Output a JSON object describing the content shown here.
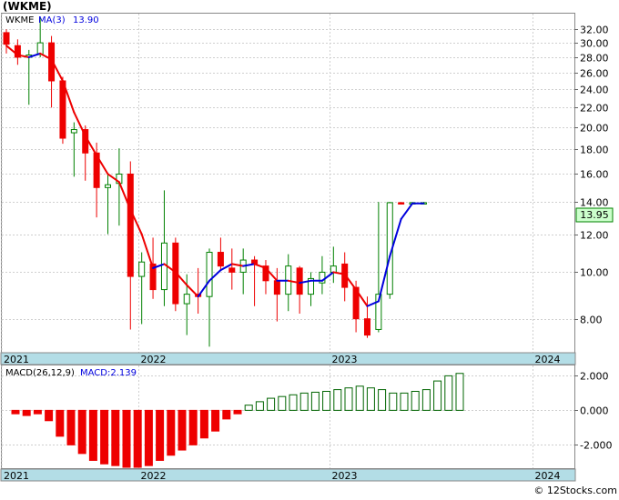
{
  "ticker_title": "(WKME)",
  "footer": "© 12Stocks.com",
  "colors": {
    "up": "#008000",
    "down": "#ee0000",
    "ma_up": "#0000dd",
    "ma_down": "#ee0000",
    "macd_hist": "#ee0000",
    "macd_hist_pos": "#006400",
    "axis_band": "#b3dde6",
    "price_tag_bg": "#ccffcc"
  },
  "chart_data": [
    {
      "type": "candlestick",
      "legend": {
        "symbol": "WKME",
        "ma_label": "MA(3)",
        "ma_value": "13.90"
      },
      "scale": "log",
      "ylim": [
        6.8,
        34.5
      ],
      "y_ticks": [
        {
          "v": 32,
          "label": "32.00"
        },
        {
          "v": 30,
          "label": "30.00"
        },
        {
          "v": 28,
          "label": "28.00"
        },
        {
          "v": 26,
          "label": "26.00"
        },
        {
          "v": 24,
          "label": "24.00"
        },
        {
          "v": 22,
          "label": "22.00"
        },
        {
          "v": 20,
          "label": "20.00"
        },
        {
          "v": 18,
          "label": "18.00"
        },
        {
          "v": 16,
          "label": "16.00"
        },
        {
          "v": 14,
          "label": "14.00"
        },
        {
          "v": 12,
          "label": "12.00"
        },
        {
          "v": 10,
          "label": "10.00"
        },
        {
          "v": 8,
          "label": "8.00"
        }
      ],
      "last_price_label": "13.95",
      "last_price": 13.95,
      "x_ticks": [
        {
          "i": 0,
          "label": "2021"
        },
        {
          "i": 12,
          "label": "2022"
        },
        {
          "i": 29,
          "label": "2023"
        },
        {
          "i": 47,
          "label": "2024"
        }
      ],
      "ohlc": [
        [
          31.5,
          32.0,
          28.5,
          29.8
        ],
        [
          29.6,
          30.5,
          27.0,
          28.0
        ],
        [
          28.0,
          29.0,
          22.3,
          28.3
        ],
        [
          28.4,
          33.8,
          28.0,
          30.0
        ],
        [
          30.0,
          31.0,
          22.0,
          25.0
        ],
        [
          25.0,
          25.5,
          18.5,
          19.0
        ],
        [
          19.5,
          20.5,
          15.8,
          19.8
        ],
        [
          19.8,
          20.2,
          15.5,
          17.7
        ],
        [
          17.7,
          18.6,
          13.0,
          15.0
        ],
        [
          15.0,
          16.0,
          12.0,
          15.2
        ],
        [
          15.3,
          18.1,
          12.5,
          16.0
        ],
        [
          16.0,
          17.0,
          7.6,
          9.8
        ],
        [
          9.8,
          11.0,
          7.8,
          10.5
        ],
        [
          10.4,
          11.8,
          8.8,
          9.2
        ],
        [
          9.2,
          14.8,
          8.5,
          11.5
        ],
        [
          11.5,
          11.8,
          8.3,
          8.6
        ],
        [
          8.6,
          9.9,
          7.4,
          9.0
        ],
        [
          9.0,
          10.2,
          8.2,
          8.9
        ],
        [
          8.9,
          11.2,
          7.0,
          11.0
        ],
        [
          11.0,
          11.8,
          10.1,
          10.3
        ],
        [
          10.2,
          11.2,
          9.2,
          10.0
        ],
        [
          10.0,
          11.2,
          9.0,
          10.6
        ],
        [
          10.6,
          10.8,
          8.5,
          10.4
        ],
        [
          10.3,
          10.6,
          9.0,
          9.6
        ],
        [
          9.6,
          10.2,
          7.9,
          9.0
        ],
        [
          9.0,
          10.9,
          8.3,
          10.3
        ],
        [
          10.2,
          10.3,
          8.2,
          9.0
        ],
        [
          9.0,
          10.0,
          8.5,
          9.7
        ],
        [
          9.5,
          10.8,
          9.0,
          10.0
        ],
        [
          10.0,
          11.3,
          9.5,
          10.3
        ],
        [
          10.4,
          11.0,
          8.7,
          9.3
        ],
        [
          9.3,
          9.6,
          7.5,
          8.0
        ],
        [
          8.0,
          8.9,
          7.3,
          7.4
        ],
        [
          7.6,
          14.0,
          7.5,
          9.0
        ],
        [
          9.0,
          14.0,
          8.8,
          13.95
        ],
        [
          13.95,
          14.0,
          13.85,
          13.9
        ],
        [
          13.9,
          14.0,
          13.85,
          13.95
        ],
        [
          13.95,
          14.0,
          13.9,
          13.95
        ]
      ],
      "ma": [
        29.6,
        28.3,
        28.0,
        28.5,
        27.7,
        25.0,
        21.5,
        19.2,
        17.5,
        16.0,
        15.4,
        13.5,
        12.0,
        10.2,
        10.4,
        10.0,
        9.4,
        8.9,
        9.6,
        10.1,
        10.4,
        10.3,
        10.4,
        10.2,
        9.6,
        9.6,
        9.5,
        9.6,
        9.6,
        10.0,
        9.9,
        9.2,
        8.5,
        8.7,
        10.8,
        12.9,
        13.9,
        13.9
      ]
    },
    {
      "type": "bar",
      "legend": {
        "label": "MACD(26,12,9)",
        "value_label": "MACD:2.139"
      },
      "ylim": [
        -3.35,
        2.6
      ],
      "y_ticks": [
        {
          "v": 2,
          "label": "2.000"
        },
        {
          "v": 0,
          "label": "0.000"
        },
        {
          "v": -2,
          "label": "-2.000"
        }
      ],
      "x_ticks": [
        {
          "i": 0,
          "label": "2021"
        },
        {
          "i": 12,
          "label": "2022"
        },
        {
          "i": 29,
          "label": "2023"
        },
        {
          "i": 47,
          "label": "2024"
        }
      ],
      "values": [
        -0.2,
        -0.3,
        -0.2,
        -0.6,
        -1.5,
        -2.0,
        -2.5,
        -2.9,
        -3.1,
        -3.2,
        -3.3,
        -3.3,
        -3.2,
        -2.9,
        -2.6,
        -2.3,
        -2.0,
        -1.6,
        -1.2,
        -0.5,
        -0.2,
        0.3,
        0.5,
        0.7,
        0.8,
        0.9,
        1.0,
        1.05,
        1.1,
        1.2,
        1.3,
        1.4,
        1.3,
        1.2,
        1.0,
        1.0,
        1.1,
        1.2,
        1.7,
        2.0,
        2.139
      ]
    }
  ]
}
